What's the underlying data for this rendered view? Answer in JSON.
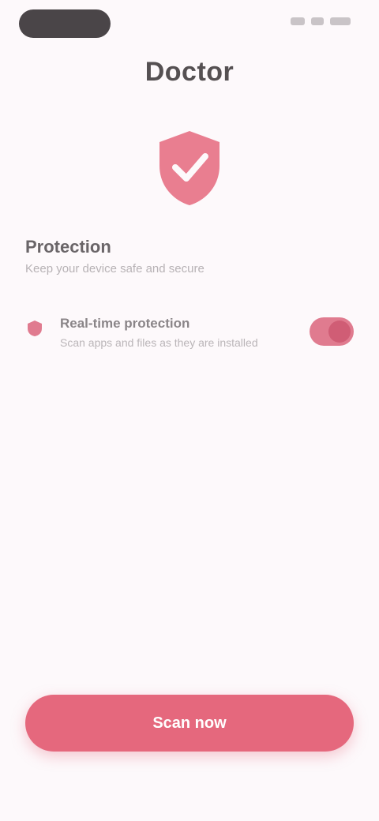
{
  "header": {
    "title": "Doctor"
  },
  "shield": {
    "icon": "shield-check-icon",
    "accent_color": "#e5687d"
  },
  "section": {
    "title": "Protection",
    "subtitle": "Keep your device safe and secure"
  },
  "setting": {
    "icon": "shield-small-icon",
    "title": "Real-time protection",
    "description": "Scan apps and files as they are installed",
    "enabled": true
  },
  "action": {
    "label": "Scan now"
  },
  "footer": {
    "note": ""
  },
  "colors": {
    "accent": "#e5687d",
    "background": "#fdf9fb"
  }
}
